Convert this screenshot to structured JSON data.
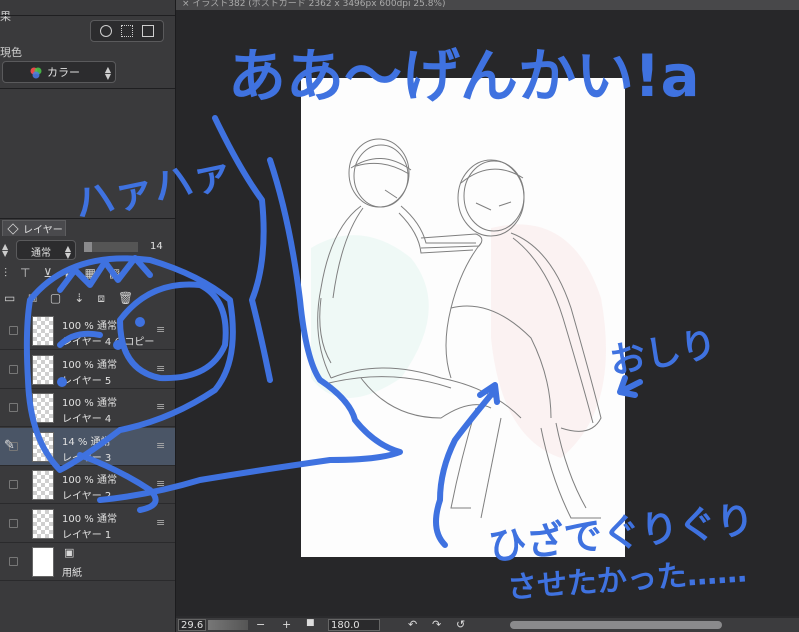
{
  "window": {
    "title": "イラスト382 (ポストカード 2362 x 3496px 600dpi 25.8%)"
  },
  "left_panel": {
    "effect_label": "果",
    "color_label": "現色",
    "color_mode_value": "カラー"
  },
  "layer_panel": {
    "tab_label": "レイヤー",
    "blend_mode": "通常",
    "opacity_value": "14",
    "opacity_fraction": 0.14,
    "layers": [
      {
        "opacity": "100 % 通常",
        "name": "レイヤー 4 のコピー"
      },
      {
        "opacity": "100 % 通常",
        "name": "レイヤー 5"
      },
      {
        "opacity": "100 % 通常",
        "name": "レイヤー 4"
      },
      {
        "opacity": "14 % 通常",
        "name": "レイヤー 3"
      },
      {
        "opacity": "100 % 通常",
        "name": "レイヤー 2"
      },
      {
        "opacity": "100 % 通常",
        "name": "レイヤー 1"
      },
      {
        "opacity": "",
        "name": "用紙"
      }
    ]
  },
  "status_bar": {
    "zoom_value": "29.6",
    "rotation_value": "180.0"
  },
  "annotations": {
    "headline": "ああ〜げんかい!a",
    "gasp": "ハァハァ",
    "oshiri": "おしり",
    "arrow_mark": "↖",
    "hiza": "ひざでぐりぐり",
    "wanted": "させたかった……"
  },
  "colors": {
    "ink": "#3f72e0",
    "panel": "#3a3a3c",
    "selected_layer": "#4a5566",
    "canvas_bg": "#272729"
  }
}
